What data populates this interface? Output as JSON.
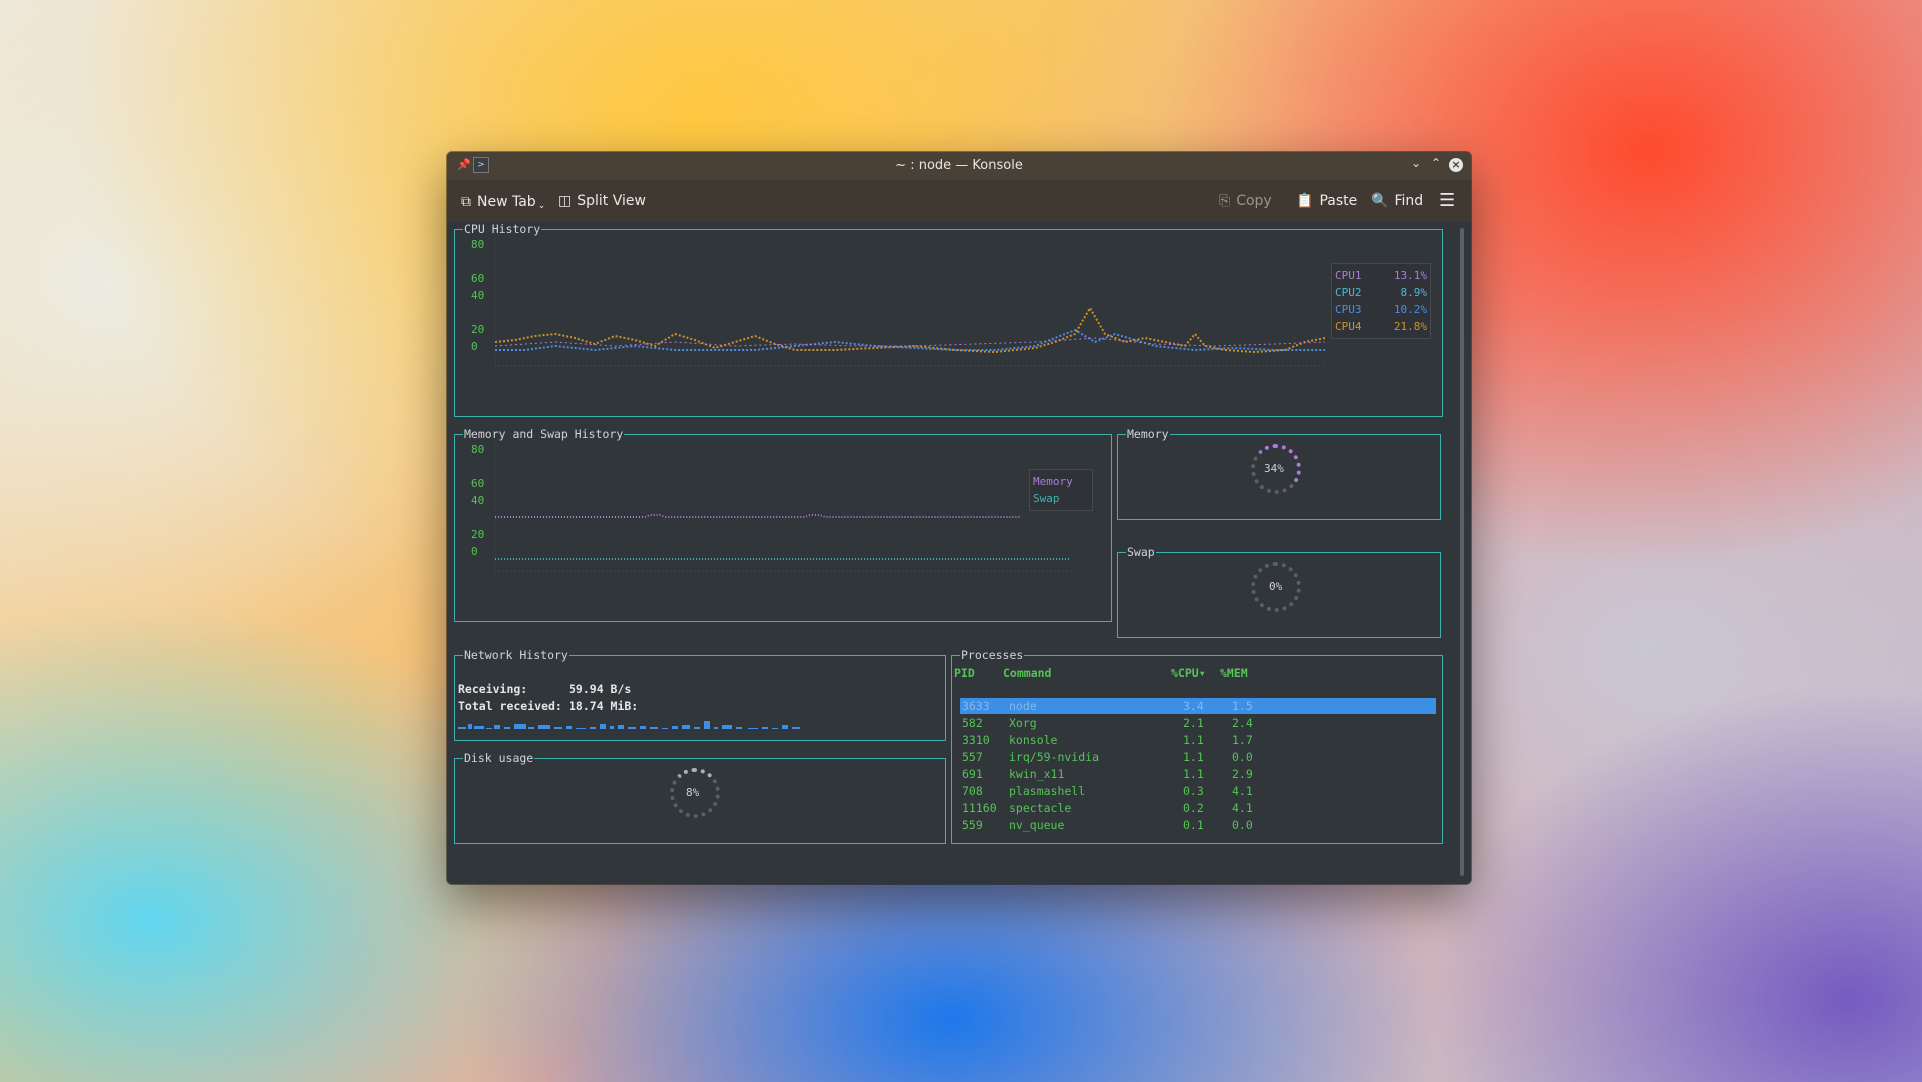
{
  "window": {
    "title": "~ : node — Konsole"
  },
  "toolbar": {
    "new_tab": "New Tab",
    "split_view": "Split View",
    "copy": "Copy",
    "paste": "Paste",
    "find": "Find"
  },
  "cpu": {
    "title": "CPU History",
    "yticks": [
      "80",
      "60",
      "40",
      "20",
      "0"
    ],
    "legend": [
      {
        "name": "CPU1",
        "value": "13.1%",
        "color": "#b07bd8"
      },
      {
        "name": "CPU2",
        "value": "8.9%",
        "color": "#4fb6d6"
      },
      {
        "name": "CPU3",
        "value": "10.2%",
        "color": "#4a8ee0"
      },
      {
        "name": "CPU4",
        "value": "21.8%",
        "color": "#d0902a"
      }
    ]
  },
  "memswap": {
    "title": "Memory and Swap History",
    "yticks": [
      "80",
      "60",
      "40",
      "20",
      "0"
    ],
    "legend": [
      {
        "name": "Memory",
        "color": "#b07bd8"
      },
      {
        "name": "Swap",
        "color": "#3fb0b0"
      }
    ]
  },
  "memory": {
    "title": "Memory",
    "percent": "34%",
    "value": 34
  },
  "swap": {
    "title": "Swap",
    "percent": "0%",
    "value": 0
  },
  "network": {
    "title": "Network History",
    "receiving_label": "Receiving:",
    "receiving_value": "59.94  B/s",
    "total_label": "Total received:",
    "total_value": "18.74 MiB:"
  },
  "disk": {
    "title": "Disk usage",
    "percent": "8%",
    "value": 8
  },
  "processes": {
    "title": "Processes",
    "headers": [
      "PID",
      "Command",
      "%CPU▾",
      "%MEM"
    ],
    "rows": [
      {
        "pid": "3633",
        "cmd": "node",
        "cpu": "3.4",
        "mem": "1.5",
        "selected": true
      },
      {
        "pid": "582",
        "cmd": "Xorg",
        "cpu": "2.1",
        "mem": "2.4"
      },
      {
        "pid": "3310",
        "cmd": "konsole",
        "cpu": "1.1",
        "mem": "1.7"
      },
      {
        "pid": "557",
        "cmd": "irq/59-nvidia",
        "cpu": "1.1",
        "mem": "0.0"
      },
      {
        "pid": "691",
        "cmd": "kwin_x11",
        "cpu": "1.1",
        "mem": "2.9"
      },
      {
        "pid": "708",
        "cmd": "plasmashell",
        "cpu": "0.3",
        "mem": "4.1"
      },
      {
        "pid": "11160",
        "cmd": "spectacle",
        "cpu": "0.2",
        "mem": "4.1"
      },
      {
        "pid": "559",
        "cmd": "nv_queue",
        "cpu": "0.1",
        "mem": "0.0"
      }
    ]
  }
}
